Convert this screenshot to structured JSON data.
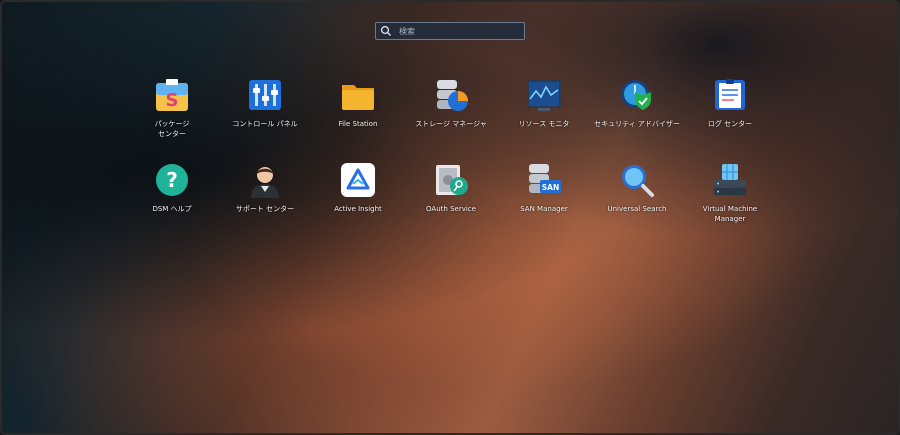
{
  "search": {
    "placeholder": "検索"
  },
  "apps": {
    "row1": [
      {
        "label": "パッケージ\nセンター",
        "icon": "package-center-icon"
      },
      {
        "label": "コントロール パネル",
        "icon": "control-panel-icon"
      },
      {
        "label": "File Station",
        "icon": "folder-icon"
      },
      {
        "label": "ストレージ マネージャ",
        "icon": "storage-manager-icon"
      },
      {
        "label": "リソース モニタ",
        "icon": "resource-monitor-icon"
      },
      {
        "label": "セキュリティ アドバイザー",
        "icon": "security-advisor-icon"
      },
      {
        "label": "ログ センター",
        "icon": "log-center-icon"
      }
    ],
    "row2": [
      {
        "label": "DSM ヘルプ",
        "icon": "help-icon"
      },
      {
        "label": "サポート センター",
        "icon": "support-center-icon"
      },
      {
        "label": "Active Insight",
        "icon": "active-insight-icon"
      },
      {
        "label": "OAuth Service",
        "icon": "oauth-service-icon"
      },
      {
        "label": "SAN Manager",
        "icon": "san-manager-icon"
      },
      {
        "label": "Universal Search",
        "icon": "universal-search-icon"
      },
      {
        "label": "Virtual Machine\nManager",
        "icon": "virtual-machine-manager-icon"
      }
    ]
  },
  "san_badge": "SAN",
  "colors": {
    "search_bg": "#232d3c",
    "folder": "#f5b52e",
    "help": "#1fb39a",
    "security": "#2f9be0"
  }
}
